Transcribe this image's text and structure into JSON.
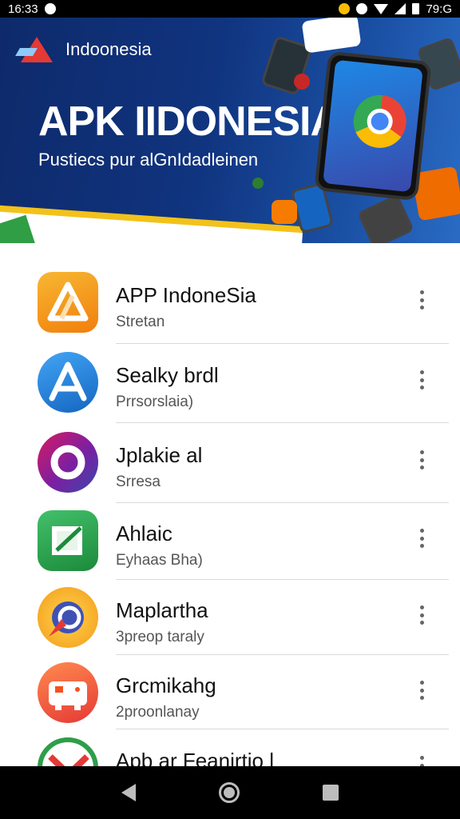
{
  "status_bar": {
    "time": "16:33",
    "clock": "79:G",
    "icons": [
      "notification-icon",
      "chrome-icon",
      "circle-icon",
      "wifi-icon",
      "signal-icon",
      "battery-icon"
    ]
  },
  "banner": {
    "brand_name": "Indoonesia",
    "title": "APK IIDONESIA",
    "subtitle": "Pustiecs pur alGnIdadleinen",
    "colors": {
      "background": "#10347f",
      "accent_yellow": "#f2c21b",
      "logo_red": "#e53935"
    }
  },
  "apps": [
    {
      "name": "APP IndoneSia",
      "subtitle": "Stretan",
      "icon": "warning-triangle-app-icon",
      "color": "#f39c12"
    },
    {
      "name": "Sealky brdl",
      "subtitle": "Prrsorslaia)",
      "icon": "app-store-a-icon",
      "color": "#1e88e5"
    },
    {
      "name": "Jplakie al",
      "subtitle": "Srresa",
      "icon": "purple-ring-app-icon",
      "color": "#8e24aa"
    },
    {
      "name": "Ahlaic",
      "subtitle": "Eyhaas Bha)",
      "icon": "green-square-app-icon",
      "color": "#2e9e48"
    },
    {
      "name": "Maplartha",
      "subtitle": "3preop taraly",
      "icon": "compass-app-icon",
      "color": "#f5b81d"
    },
    {
      "name": "Grcmikahg",
      "subtitle": "2proonlanay",
      "icon": "gamepad-app-icon",
      "color": "#f4511e"
    },
    {
      "name": "Apb ar Feanirtio l",
      "subtitle": "",
      "icon": "gmail-app-icon",
      "color": "#2e9e48"
    }
  ],
  "nav": {
    "icons": [
      "back-icon",
      "home-icon",
      "recents-icon"
    ]
  }
}
